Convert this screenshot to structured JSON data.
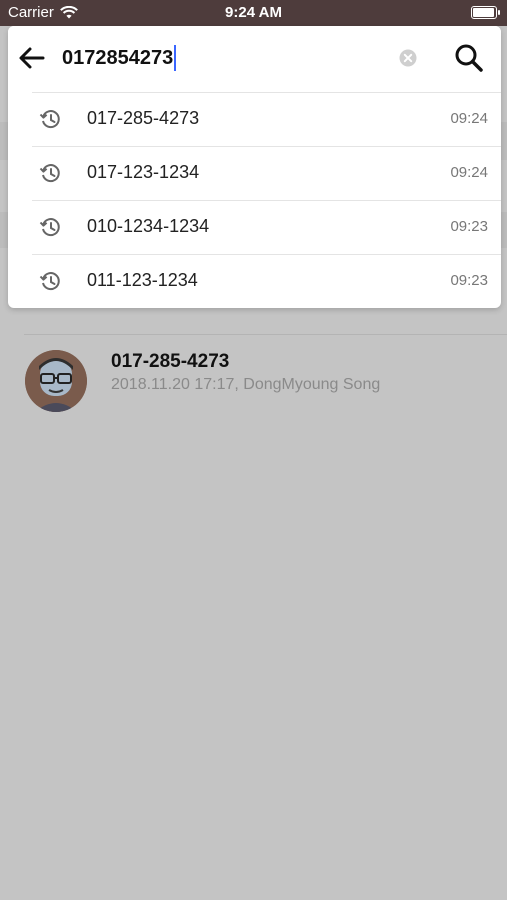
{
  "status_bar": {
    "carrier": "Carrier",
    "time": "9:24 AM",
    "battery_level": 0.95
  },
  "search": {
    "query": "0172854273"
  },
  "suggestions": [
    {
      "number": "017-285-4273",
      "time": "09:24"
    },
    {
      "number": "017-123-1234",
      "time": "09:24"
    },
    {
      "number": "010-1234-1234",
      "time": "09:23"
    },
    {
      "number": "011-123-1234",
      "time": "09:23"
    }
  ],
  "result": {
    "title": "017-285-4273",
    "subtitle": "2018.11.20 17:17, DongMyoung Song"
  },
  "colors": {
    "header_bg": "#4e3c3c",
    "caret": "#3a66ff",
    "overlay_gray": "#c4c4c4"
  }
}
